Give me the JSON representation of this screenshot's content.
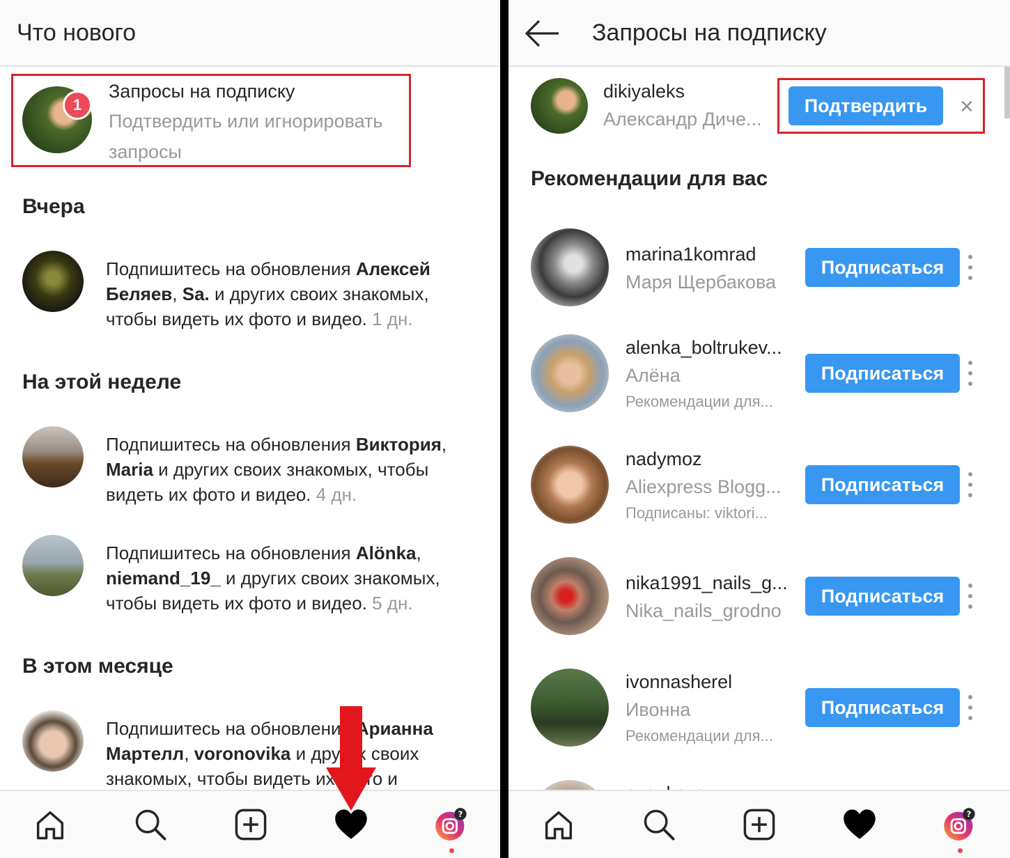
{
  "left": {
    "title": "Что нового",
    "request": {
      "title": "Запросы на подписку",
      "subtitle": "Подтвердить или игнорировать запросы",
      "badge": "1"
    },
    "sections": {
      "yesterday": "Вчера",
      "this_week": "На этой неделе",
      "this_month": "В этом месяце"
    },
    "notifications": [
      {
        "pre": "Подпишитесь на обновления ",
        "bold1": "Алексей Беляев",
        "mid1": ", ",
        "bold2": "Sa.",
        "post": " и других своих знакомых, чтобы видеть их фото и видео. ",
        "time": "1 дн."
      },
      {
        "pre": "Подпишитесь на обновления ",
        "bold1": "Виктория",
        "mid1": ", ",
        "bold2": "Maria",
        "post": " и других своих знакомых, чтобы видеть их фото и видео. ",
        "time": "4 дн."
      },
      {
        "pre": "Подпишитесь на обновления ",
        "bold1": "Alönka",
        "mid1": ", ",
        "bold2": "niemand_19_",
        "post": " и других своих знакомых, чтобы видеть их фото и видео. ",
        "time": "5 дн."
      },
      {
        "pre": "Подпишитесь на обновления ",
        "bold1": "Арианна Мартелл",
        "mid1": ", ",
        "bold2": "voronovika",
        "post": " и других своих знакомых, чтобы видеть их фото и",
        "time": ""
      }
    ]
  },
  "right": {
    "title": "Запросы на подписку",
    "request_user": {
      "username": "dikiyaleks",
      "fullname": "Александр Диче...",
      "confirm_label": "Подтвердить",
      "dismiss_label": "×"
    },
    "recommend_heading": "Рекомендации для вас",
    "follow_label": "Подписаться",
    "suggestions": [
      {
        "username": "marina1komrad",
        "fullname": "Маря Щербакова",
        "hint": ""
      },
      {
        "username": "alenka_boltrukev...",
        "fullname": "Алёна",
        "hint": "Рекомендации для..."
      },
      {
        "username": "nadymoz",
        "fullname": "Aliexpress Blogg...",
        "hint": "Подписаны: viktori..."
      },
      {
        "username": "nika1991_nails_g...",
        "fullname": "Nika_nails_grodno",
        "hint": ""
      },
      {
        "username": "ivonnasherel",
        "fullname": "Ивонна",
        "hint": "Рекомендации для..."
      },
      {
        "username": "eva_kava",
        "fullname": "",
        "hint": ""
      }
    ]
  },
  "nav_icons": [
    "home-icon",
    "search-icon",
    "add-post-icon",
    "activity-heart-icon",
    "profile-avatar-icon"
  ],
  "colors": {
    "accent_blue": "#3897f0",
    "highlight_red": "#d8222a",
    "badge_red": "#ed4956",
    "secondary_text": "#999999"
  }
}
